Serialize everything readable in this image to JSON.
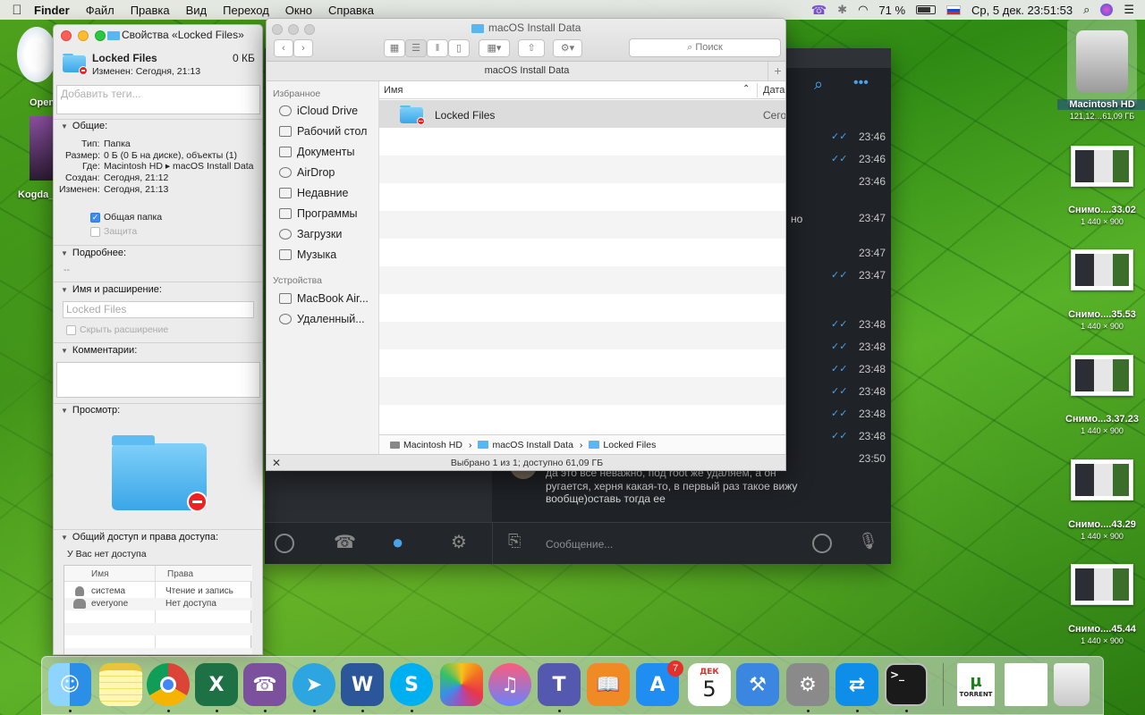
{
  "menubar": {
    "app_name": "Finder",
    "items": [
      "Файл",
      "Правка",
      "Вид",
      "Переход",
      "Окно",
      "Справка"
    ],
    "battery": "71 %",
    "datetime": "Ср, 5 дек.  23:51:53"
  },
  "info_window": {
    "title": "Свойства «Locked Files»",
    "name": "Locked Files",
    "size": "0 КБ",
    "modified_line": "Изменен: Сегодня, 21:13",
    "tags_placeholder": "Добавить теги...",
    "general_head": "Общие:",
    "kind_label": "Тип:",
    "kind_value": "Папка",
    "size_label": "Размер:",
    "size_value": "0 Б (0 Б на диске), объекты (1)",
    "where_label": "Где:",
    "where_value": "Macintosh HD ▸ macOS Install Data",
    "created_label": "Создан:",
    "created_value": "Сегодня, 21:12",
    "modified_label": "Изменен:",
    "modified_value": "Сегодня, 21:13",
    "shared_folder": "Общая папка",
    "locked": "Защита",
    "more_head": "Подробнее:",
    "more_value": "--",
    "name_ext_head": "Имя и расширение:",
    "name_field": "Locked Files",
    "hide_ext": "Скрыть расширение",
    "comments_head": "Комментарии:",
    "preview_head": "Просмотр:",
    "sharing_head": "Общий доступ и права доступа:",
    "no_access_note": "У Вас нет доступа",
    "perm_col_name": "Имя",
    "perm_col_rights": "Права",
    "permissions": [
      {
        "name": "система",
        "rights": "Чтение и запись"
      },
      {
        "name": "everyone",
        "rights": "Нет доступа"
      }
    ]
  },
  "finder": {
    "title": "macOS Install Data",
    "search_placeholder": "Поиск",
    "path_title": "macOS Install Data",
    "sidebar": {
      "favorites_head": "Избранное",
      "favorites": [
        "iCloud Drive",
        "Рабочий стол",
        "Документы",
        "AirDrop",
        "Недавние",
        "Программы",
        "Загрузки",
        "Музыка"
      ],
      "devices_head": "Устройства",
      "devices": [
        "MacBook Air...",
        "Удаленный..."
      ]
    },
    "columns": {
      "name": "Имя",
      "date": "Дата"
    },
    "rows": [
      {
        "name": "Locked Files",
        "date": "Сегодня"
      }
    ],
    "path": [
      "Macintosh HD",
      "macOS Install Data",
      "Locked Files"
    ],
    "status": "Выбрано 1 из 1; доступно 61,09 ГБ"
  },
  "telegram": {
    "times": [
      "23:46",
      "23:46",
      "23:46",
      "23:47",
      "23:47",
      "23:47",
      "23:48",
      "23:48",
      "23:48",
      "23:48",
      "23:48",
      "23:48",
      "23:50"
    ],
    "fragment_no": "но",
    "message_lines": [
      "да это все неважно, под root же удаляем, а он",
      "ругается, херня какая-то, в первый раз такое вижу",
      "вообще)оставь тогда ее"
    ],
    "message_placeholder": "Сообщение..."
  },
  "desktop": {
    "left_icons": [
      "Open",
      "Kogda_"
    ],
    "hd_label": "Macintosh HD",
    "hd_sub": "121,12…61,09 ГБ",
    "screenshots": [
      {
        "name": "Снимо....33.02",
        "dims": "1 440 × 900"
      },
      {
        "name": "Снимо....35.53",
        "dims": "1 440 × 900"
      },
      {
        "name": "Снимо...3.37.23",
        "dims": "1 440 × 900"
      },
      {
        "name": "Снимо....43.29",
        "dims": "1 440 × 900"
      },
      {
        "name": "Снимо....45.44",
        "dims": "1 440 × 900"
      }
    ]
  },
  "dock": {
    "calendar_month": "ДЕК",
    "calendar_day": "5",
    "appstore_badge": "7",
    "torrent_label": "TORRENT"
  }
}
